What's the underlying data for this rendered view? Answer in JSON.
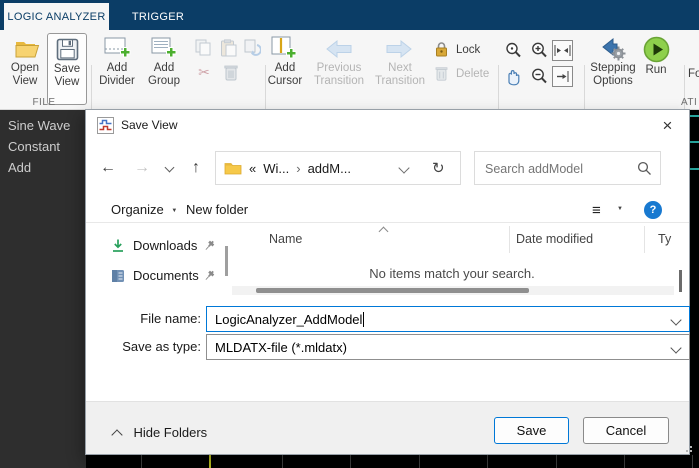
{
  "ribbon": {
    "tabs": [
      {
        "label": "LOGIC ANALYZER"
      },
      {
        "label": "TRIGGER"
      }
    ],
    "buttons": {
      "open_view": "Open View",
      "save_view": "Save View",
      "add_divider": "Add Divider",
      "add_group": "Add Group",
      "add_cursor": "Add Cursor",
      "previous_transition": "Previous Transition",
      "next_transition": "Next Transition",
      "lock": "Lock",
      "delete": "Delete",
      "stepping_options": "Stepping Options",
      "run": "Run",
      "clipped_right": "Fo"
    },
    "group_labels": {
      "file": "FILE",
      "clipped_right": "ATI"
    }
  },
  "signal_panel": {
    "signals": [
      "Sine Wave",
      "Constant",
      "Add"
    ]
  },
  "dialog": {
    "title": "Save View",
    "close_glyph": "×",
    "nav": {
      "back_glyph": "←",
      "forward_glyph": "→",
      "up_glyph": "↑",
      "refresh_glyph": "↻",
      "breadcrumb": [
        "«",
        "Wi...",
        "›",
        "addM..."
      ],
      "search_placeholder": "Search addModel"
    },
    "command_bar": {
      "organize": "Organize",
      "new_folder": "New folder",
      "view_menu_glyph": "≡",
      "help_glyph": "?"
    },
    "file_list": {
      "columns": {
        "name": "Name",
        "date_modified": "Date modified",
        "type_clipped": "Ty"
      },
      "empty_message": "No items match your search."
    },
    "places": [
      {
        "label": "Downloads"
      },
      {
        "label": "Documents"
      }
    ],
    "fields": {
      "file_name_label": "File name:",
      "file_name_value": "LogicAnalyzer_AddModel",
      "save_as_type_label": "Save as type:",
      "save_as_type_value": "MLDATX-file (*.mldatx)"
    },
    "footer": {
      "hide_folders": "Hide Folders",
      "save": "Save",
      "cancel": "Cancel"
    }
  },
  "colors": {
    "ribbon_navy": "#0b3d66",
    "accent_blue": "#0078d7",
    "run_green": "#8ed04c",
    "add_green": "#4caf2f",
    "trace_teal": "#2aa8a1",
    "cursor_yellow": "#b9bd1e",
    "help_blue": "#1879d0"
  }
}
